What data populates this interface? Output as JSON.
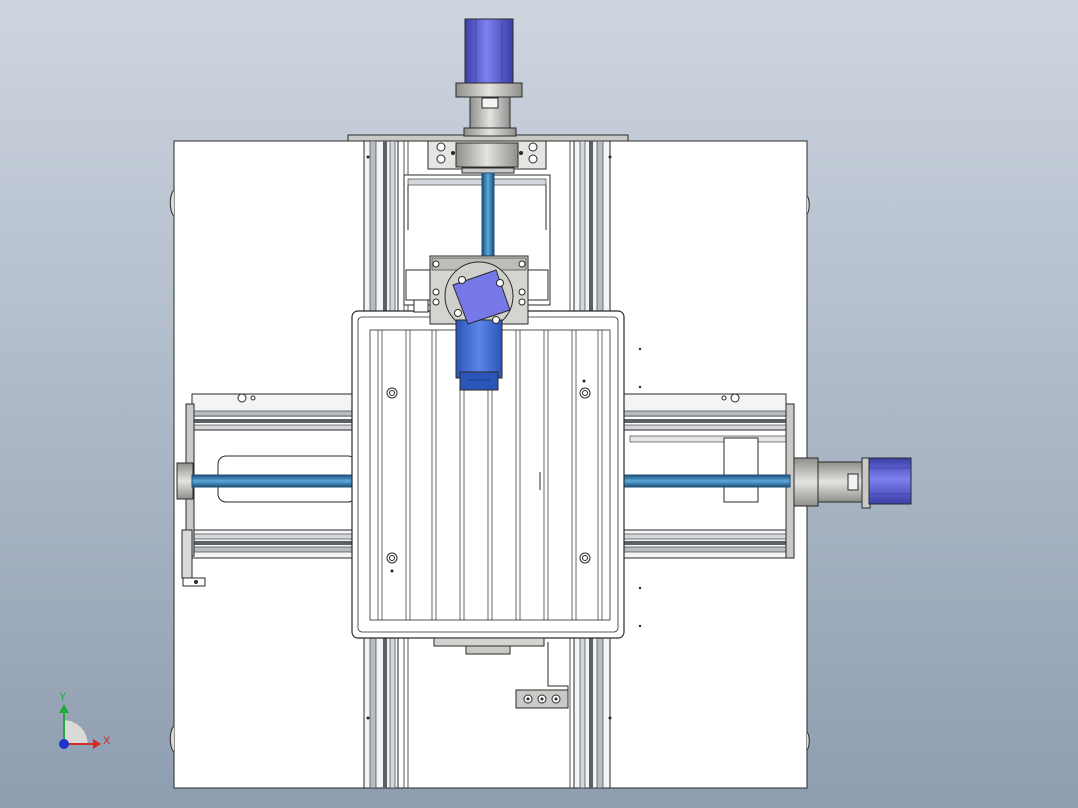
{
  "viewport": {
    "background_top": "#cdd5df",
    "background_bottom": "#8e9db0"
  },
  "colors": {
    "plate": "#ffffff",
    "line": "#2a2a2a",
    "rail_light": "#e9ebee",
    "rail_mid": "#b9bdc3",
    "rail_dark": "#5b5f66",
    "metal": "#c9c9c6",
    "metal_dark": "#8f8f8c",
    "screw": "#2e7fb8",
    "screw_dark": "#1d4f78",
    "motor_violet": "#7678e8",
    "motor_violet_dark": "#3b3fa8",
    "motor_blue": "#3e6bd6",
    "triad_y": "#1faa3a",
    "triad_x": "#d32a2a",
    "triad_z": "#2233cc"
  },
  "triad": {
    "x_label": "X",
    "y_label": "Y"
  },
  "parts": {
    "base_plate": "base-plate",
    "y_axis_motor": "y-axis-servo-motor",
    "x_axis_motor": "x-axis-servo-motor",
    "carriage_motor": "carriage-stepper-motor",
    "work_table": "slotted-work-table"
  }
}
